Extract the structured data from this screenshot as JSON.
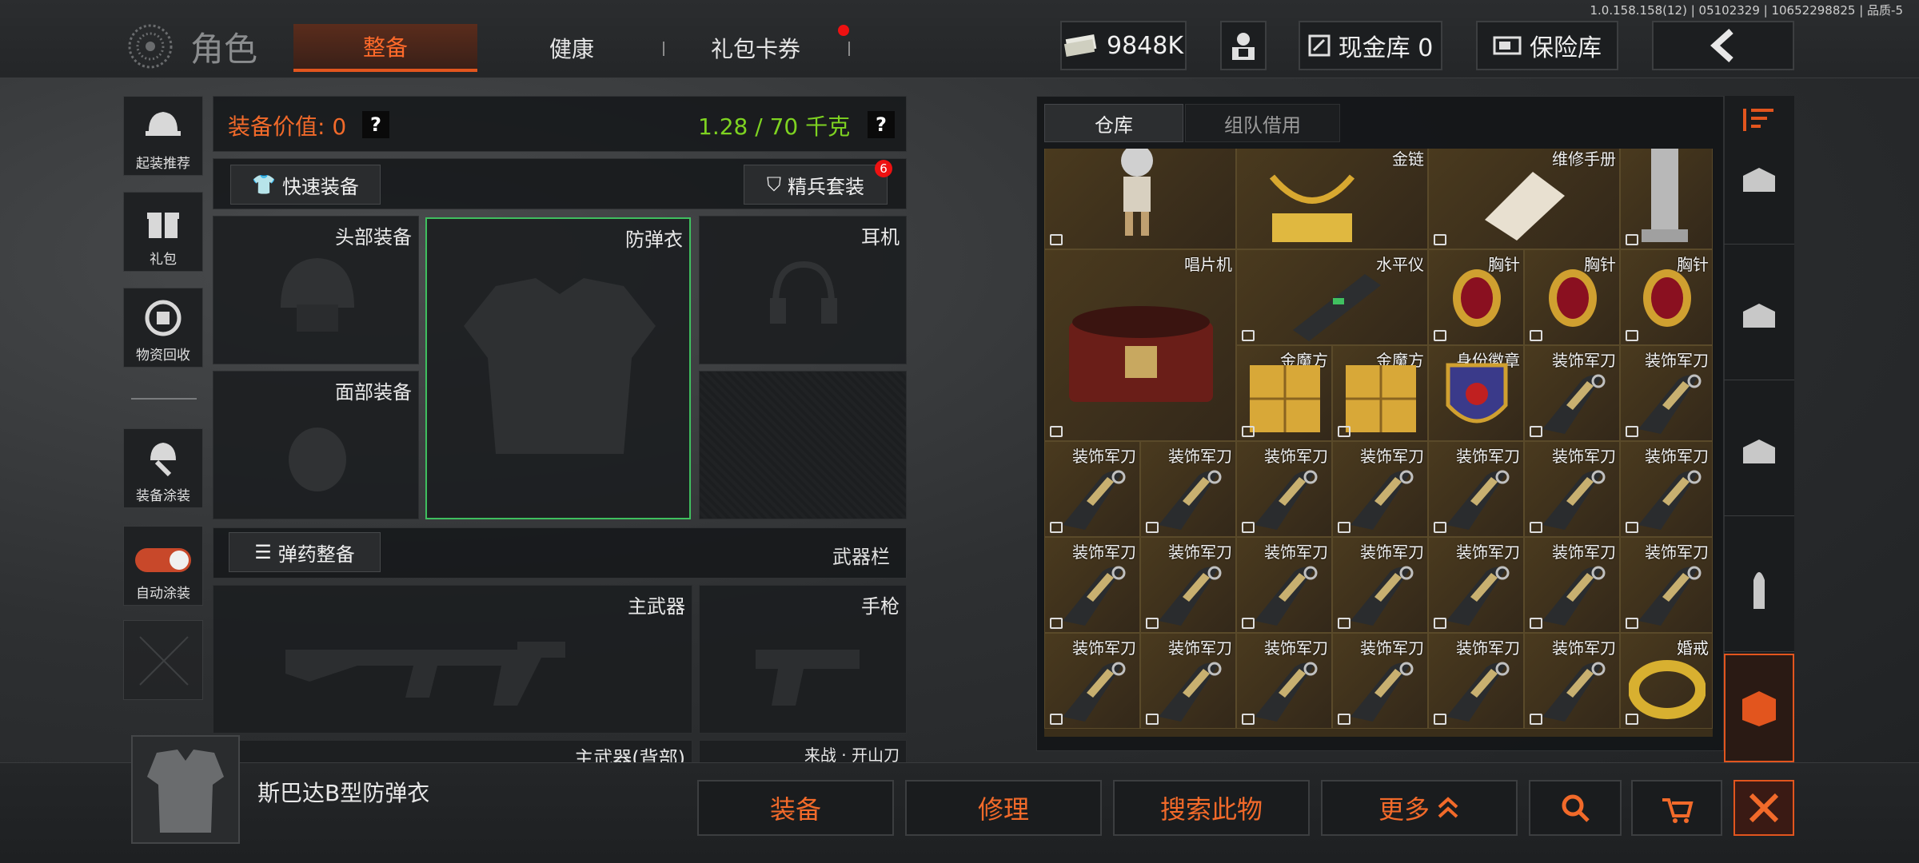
{
  "version": "1.0.158.158(12) | 05102329 | 10652298825 | 品质-5",
  "header": {
    "title": "角色",
    "tabs": [
      {
        "label": "整备",
        "active": true
      },
      {
        "label": "健康",
        "active": false
      },
      {
        "label": "礼包卡券",
        "active": false
      }
    ],
    "currency": "9848K",
    "cash_vault": "现金库 0",
    "insurance": "保险库"
  },
  "left_menu": [
    {
      "label": "起装推荐"
    },
    {
      "label": "礼包"
    },
    {
      "label": "物资回收"
    },
    {
      "label": "装备涂装"
    },
    {
      "label": "自动涂装"
    }
  ],
  "equipment": {
    "value_label": "装备价值: 0",
    "weight_label": "1.28 / 70 千克",
    "quick_equip": "快速装备",
    "elite_set": "精兵套装",
    "elite_badge": "6",
    "ammo_equip": "弹药整备",
    "weapon_bar": "武器栏",
    "slots": {
      "head": "头部装备",
      "armor": "防弹衣",
      "headset": "耳机",
      "face": "面部装备",
      "primary": "主武器",
      "pistol": "手枪",
      "primary_back": "主武器(背部)",
      "melee": "来战 · 开山刀"
    }
  },
  "storage": {
    "tabs": [
      "仓库",
      "组队借用"
    ],
    "items": {
      "gold_chain": "金链",
      "manual": "维修手册",
      "phonograph": "唱片机",
      "level": "水平仪",
      "brooch": "胸针",
      "gold_cube": "金魔方",
      "badge": "身份徽章",
      "knife": "装饰军刀",
      "ring": "婚戒"
    }
  },
  "selected_item": "斯巴达B型防弹衣",
  "actions": {
    "equip": "装备",
    "repair": "修理",
    "search": "搜索此物",
    "more": "更多"
  },
  "colors": {
    "accent": "#f26a2a",
    "green": "#7ed321",
    "red_dot": "#e11111"
  }
}
